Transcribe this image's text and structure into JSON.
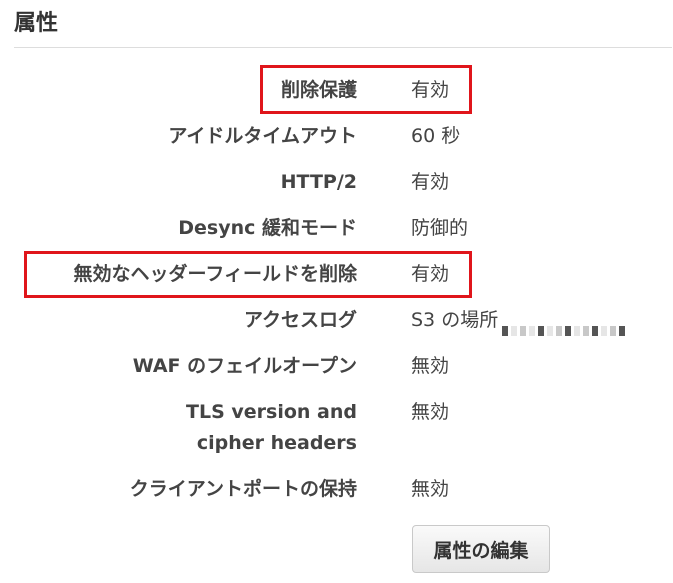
{
  "section_title": "属性",
  "attributes": [
    {
      "label": "削除保護",
      "value": "有効",
      "highlighted": true
    },
    {
      "label": "アイドルタイムアウト",
      "value": "60 秒",
      "highlighted": false
    },
    {
      "label": "HTTP/2",
      "value": "有効",
      "highlighted": false
    },
    {
      "label": "Desync 緩和モード",
      "value": "防御的",
      "highlighted": false
    },
    {
      "label": "無効なヘッダーフィールドを削除",
      "value": "有効",
      "highlighted": true
    },
    {
      "label": "アクセスログ",
      "value": "S3 の場所",
      "highlighted": false
    },
    {
      "label": "WAF のフェイルオープン",
      "value": "無効",
      "highlighted": false
    },
    {
      "label": "TLS version and cipher headers",
      "value": "無効",
      "highlighted": false
    },
    {
      "label": "クライアントポートの保持",
      "value": "無効",
      "highlighted": false
    }
  ],
  "edit_button_label": "属性の編集",
  "colors": {
    "highlight_border": "#e0151b",
    "text": "#444444",
    "divider": "#dddddd"
  }
}
